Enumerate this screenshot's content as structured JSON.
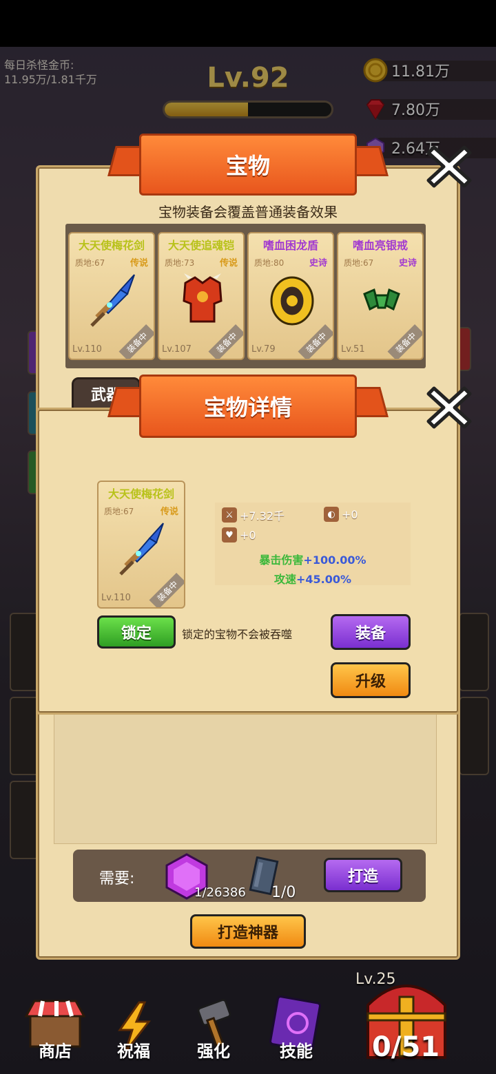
{
  "hud": {
    "daily_gold_label": "每日杀怪金币:",
    "daily_gold_value": "11.95万/1.81千万",
    "level": "Lv.92",
    "xp_progress": 0.5,
    "gold": "11.81万",
    "gems": "7.80万",
    "purple": "2.64万"
  },
  "treasure_panel": {
    "title": "宝物",
    "subtitle": "宝物装备会覆盖普通装备效果",
    "items": [
      {
        "name": "大天使梅花剑",
        "quality": "质地:67",
        "rarity": "传说",
        "level": "Lv.110",
        "status": "装备中",
        "name_color": "#b8c21a",
        "rarity_color": "#d89a1a",
        "icon": "sword-icon"
      },
      {
        "name": "大天使追魂铠",
        "quality": "质地:73",
        "rarity": "传说",
        "level": "Lv.107",
        "status": "装备中",
        "name_color": "#b8c21a",
        "rarity_color": "#d89a1a",
        "icon": "armor-icon"
      },
      {
        "name": "嗜血困龙盾",
        "quality": "质地:80",
        "rarity": "史诗",
        "level": "Lv.79",
        "status": "装备中",
        "name_color": "#a23ad0",
        "rarity_color": "#a23ad0",
        "icon": "shield-icon"
      },
      {
        "name": "嗜血亮银戒",
        "quality": "质地:67",
        "rarity": "史诗",
        "level": "Lv.51",
        "status": "装备中",
        "name_color": "#a23ad0",
        "rarity_color": "#a23ad0",
        "icon": "ring-icon"
      }
    ],
    "tab_weapon": "武器"
  },
  "detail": {
    "title": "宝物详情",
    "item": {
      "name": "大天使梅花剑",
      "quality": "质地:67",
      "rarity": "传说",
      "level": "Lv.110",
      "status": "装备中"
    },
    "stats": {
      "attack": "+7.32千",
      "defense": "+0",
      "hp": "+0",
      "crit_label": "暴击伤害",
      "crit_value": "+100.00%",
      "speed_label": "攻速",
      "speed_value": "+45.00%"
    },
    "lock_button": "锁定",
    "lock_note": "锁定的宝物不会被吞噬",
    "equip_button": "装备",
    "upgrade_button": "升级"
  },
  "forge": {
    "need_label": "需要:",
    "gem_count": "1/26386",
    "material_count": "1/0",
    "forge_button": "打造",
    "forge_artifact_button": "打造神器"
  },
  "nav": {
    "shop": "商店",
    "bless": "祝福",
    "enhance": "强化",
    "skill": "技能",
    "chest_level": "Lv.25",
    "chest_count": "0/51"
  }
}
